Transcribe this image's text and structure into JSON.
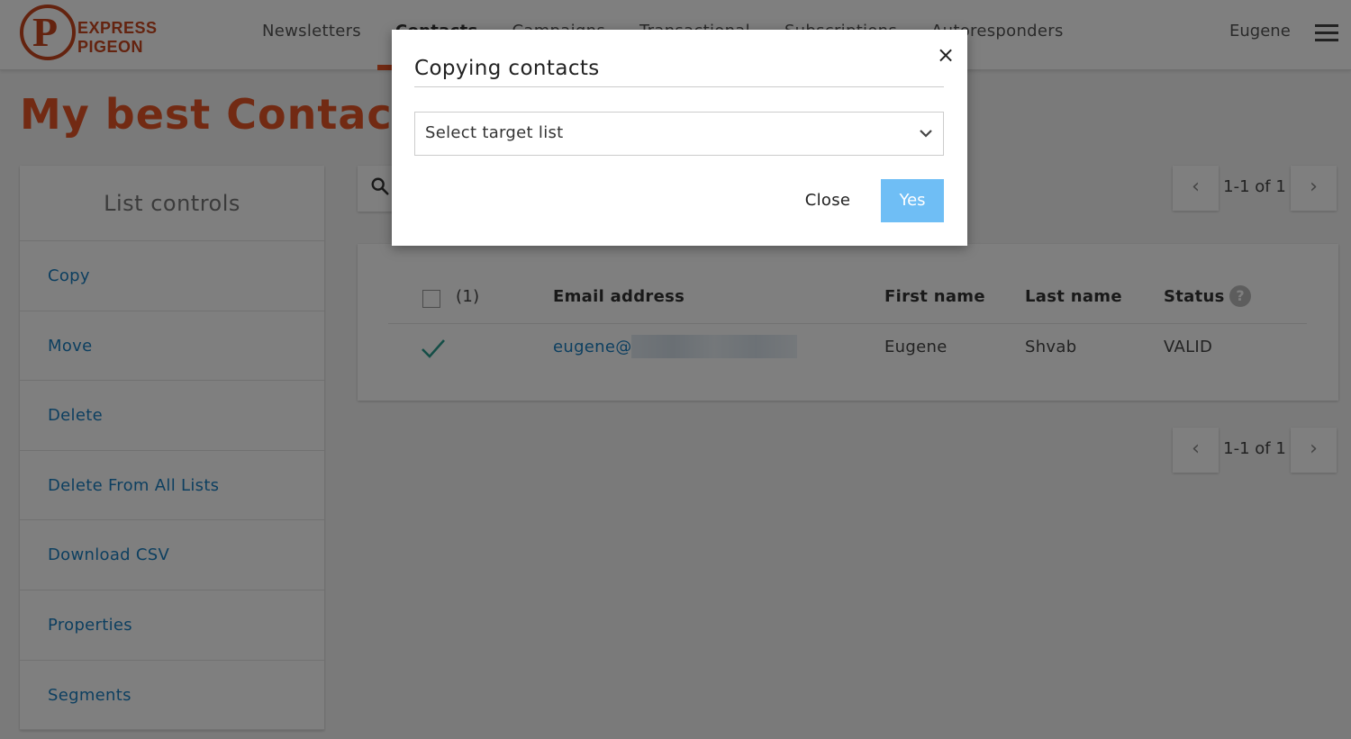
{
  "brand": {
    "logo_letter": "P",
    "line1": "EXPRESS",
    "line2": "PIGEON",
    "color": "#c8461f"
  },
  "nav": {
    "items": [
      "Newsletters",
      "Contacts",
      "Campaigns",
      "Transactional",
      "Subscriptions",
      "Autoresponders"
    ],
    "active": "Contacts",
    "user": "Eugene"
  },
  "page": {
    "title": "My best Contacts ("
  },
  "sidebar": {
    "heading": "List controls",
    "items": [
      "Copy",
      "Move",
      "Delete",
      "Delete From All Lists",
      "Download CSV",
      "Properties",
      "Segments"
    ]
  },
  "pager": {
    "count": "1-1 of 1",
    "prev": "‹",
    "next": "›"
  },
  "table": {
    "selected_count": "(1)",
    "headers": {
      "email": "Email address",
      "first_name": "First name",
      "last_name": "Last name",
      "status": "Status"
    },
    "rows": [
      {
        "email": "eugene@",
        "first_name": "Eugene",
        "last_name": "Shvab",
        "status": "VALID"
      }
    ]
  },
  "modal": {
    "title": "Copying contacts",
    "select_placeholder": "Select target list",
    "close_label": "Close",
    "confirm_label": "Yes",
    "close_icon": "×"
  },
  "colors": {
    "accent": "#e55527",
    "link": "#1b7fc0",
    "confirm": "#6fbef5",
    "check": "#2a9d8f"
  }
}
